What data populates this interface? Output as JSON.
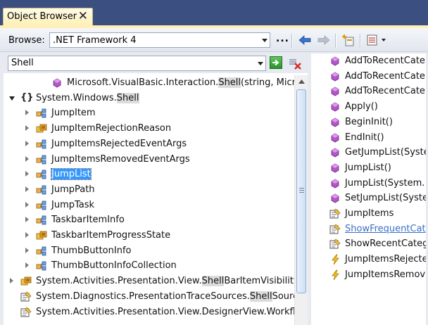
{
  "window": {
    "tab_title": "Object Browser",
    "close_glyph": "✕"
  },
  "toolbar": {
    "browse_label": "Browse:",
    "browse_value": ".NET Framework 4",
    "more_label": "...",
    "icons": [
      "back-arrow-icon",
      "forward-arrow-icon",
      "add-reference-icon",
      "settings-dropdown-icon"
    ]
  },
  "search": {
    "value": "Shell",
    "go_icon": "search-go-icon",
    "clear_icon": "clear-search-icon"
  },
  "tree": {
    "rows": [
      {
        "indent": 2,
        "expander": "none",
        "icon": "method-icon",
        "label": "Microsoft.VisualBasic.Interaction.Shell(string, Microsoft.V",
        "highlight": "Shell",
        "selected": false
      },
      {
        "indent": 0,
        "expander": "open",
        "icon": "namespace-icon",
        "label": "System.Windows.Shell",
        "highlight": "Shell",
        "selected": false
      },
      {
        "indent": 1,
        "expander": "closed",
        "icon": "class-icon",
        "label": "JumpItem",
        "highlight": "",
        "selected": false
      },
      {
        "indent": 1,
        "expander": "closed",
        "icon": "enum-icon",
        "label": "JumpItemRejectionReason",
        "highlight": "",
        "selected": false
      },
      {
        "indent": 1,
        "expander": "closed",
        "icon": "class-icon",
        "label": "JumpItemsRejectedEventArgs",
        "highlight": "",
        "selected": false
      },
      {
        "indent": 1,
        "expander": "closed",
        "icon": "class-icon",
        "label": "JumpItemsRemovedEventArgs",
        "highlight": "",
        "selected": false
      },
      {
        "indent": 1,
        "expander": "closed",
        "icon": "class-icon",
        "label": "JumpList",
        "highlight": "",
        "selected": true
      },
      {
        "indent": 1,
        "expander": "closed",
        "icon": "class-icon",
        "label": "JumpPath",
        "highlight": "",
        "selected": false
      },
      {
        "indent": 1,
        "expander": "closed",
        "icon": "class-icon",
        "label": "JumpTask",
        "highlight": "",
        "selected": false
      },
      {
        "indent": 1,
        "expander": "closed",
        "icon": "class-icon",
        "label": "TaskbarItemInfo",
        "highlight": "",
        "selected": false
      },
      {
        "indent": 1,
        "expander": "closed",
        "icon": "enum-icon",
        "label": "TaskbarItemProgressState",
        "highlight": "",
        "selected": false
      },
      {
        "indent": 1,
        "expander": "closed",
        "icon": "class-icon",
        "label": "ThumbButtonInfo",
        "highlight": "",
        "selected": false
      },
      {
        "indent": 1,
        "expander": "closed",
        "icon": "class-icon",
        "label": "ThumbButtonInfoCollection",
        "highlight": "",
        "selected": false
      },
      {
        "indent": 0,
        "expander": "closed",
        "icon": "enum-icon",
        "label": "System.Activities.Presentation.View.ShellBarItemVisibility",
        "highlight": "Shell",
        "selected": false
      },
      {
        "indent": 0,
        "expander": "none",
        "icon": "property-icon",
        "label": "System.Diagnostics.PresentationTraceSources.ShellSource",
        "highlight": "Shell",
        "selected": false
      },
      {
        "indent": 0,
        "expander": "none",
        "icon": "property-icon",
        "label": "System.Activities.Presentation.View.DesignerView.Workfl",
        "highlight": "",
        "selected": false
      }
    ]
  },
  "members": {
    "rows": [
      {
        "icon": "method-icon",
        "label": "AddToRecentCate",
        "link": false
      },
      {
        "icon": "method-icon",
        "label": "AddToRecentCate",
        "link": false
      },
      {
        "icon": "method-icon",
        "label": "AddToRecentCate",
        "link": false
      },
      {
        "icon": "method-icon",
        "label": "Apply()",
        "link": false
      },
      {
        "icon": "method-icon",
        "label": "BeginInit()",
        "link": false
      },
      {
        "icon": "method-icon",
        "label": "EndInit()",
        "link": false
      },
      {
        "icon": "method-icon",
        "label": "GetJumpList(Syste",
        "link": false
      },
      {
        "icon": "method-icon",
        "label": "JumpList()",
        "link": false
      },
      {
        "icon": "method-icon",
        "label": "JumpList(System.",
        "link": false
      },
      {
        "icon": "method-icon",
        "label": "SetJumpList(Syste",
        "link": false
      },
      {
        "icon": "property-icon",
        "label": "JumpItems",
        "link": false
      },
      {
        "icon": "property-icon",
        "label": "ShowFrequentCat",
        "link": true
      },
      {
        "icon": "property-icon",
        "label": "ShowRecentCateg",
        "link": false
      },
      {
        "icon": "event-icon",
        "label": "JumpItemsRejecte",
        "link": false
      },
      {
        "icon": "event-icon",
        "label": "JumpItemsRemov",
        "link": false
      }
    ]
  }
}
